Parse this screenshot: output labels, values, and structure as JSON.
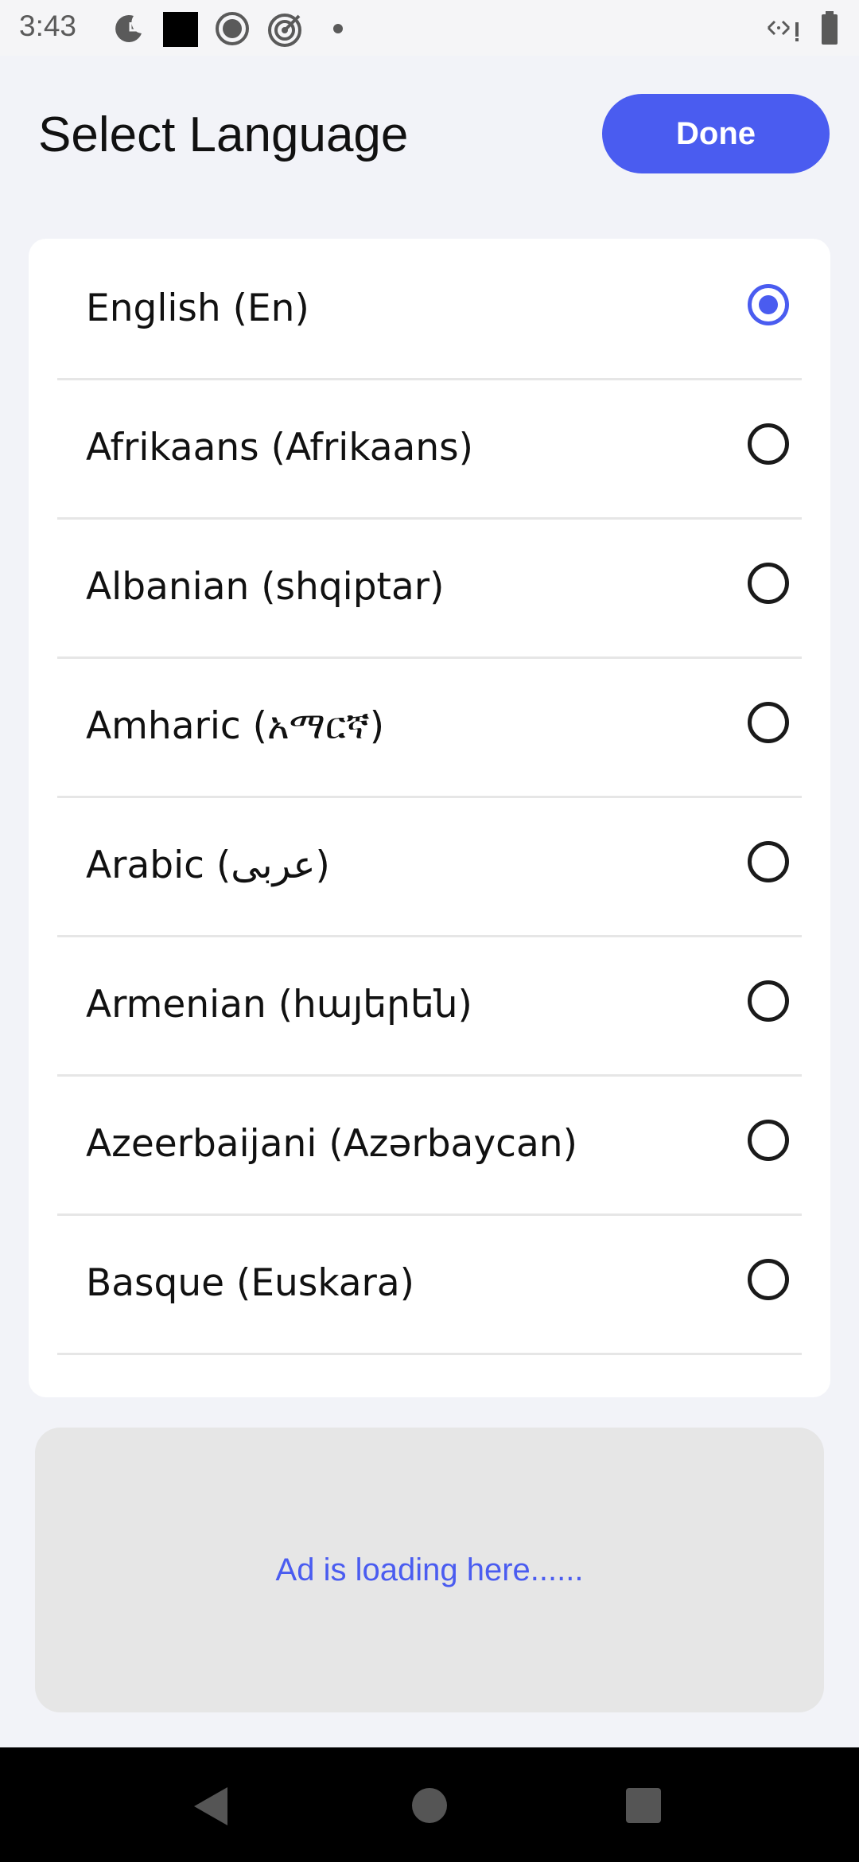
{
  "status_bar": {
    "time": "3:43",
    "left_icons": [
      "moon-clock-icon",
      "black-square-icon",
      "record-icon",
      "target-icon",
      "dot-icon"
    ],
    "right_icons": [
      "data-arrows-icon",
      "battery-icon"
    ]
  },
  "header": {
    "title": "Select Language",
    "done_label": "Done"
  },
  "languages": [
    {
      "label": "English (En)",
      "selected": true
    },
    {
      "label": "Afrikaans (Afrikaans)",
      "selected": false
    },
    {
      "label": "Albanian (shqiptar)",
      "selected": false
    },
    {
      "label": "Amharic (አማርኛ)",
      "selected": false
    },
    {
      "label": "Arabic (عربى)",
      "selected": false
    },
    {
      "label": "Armenian (հայերեն)",
      "selected": false
    },
    {
      "label": "Azeerbaijani (Azərbaycan)",
      "selected": false
    },
    {
      "label": "Basque (Euskara)",
      "selected": false
    }
  ],
  "ad": {
    "text": "Ad is loading here......"
  },
  "nav_bar": {
    "buttons": [
      "back-icon",
      "home-icon",
      "recents-icon"
    ]
  },
  "colors": {
    "accent": "#4a5cf0",
    "background": "#f2f3f8",
    "ad_background": "#e6e6e6"
  }
}
